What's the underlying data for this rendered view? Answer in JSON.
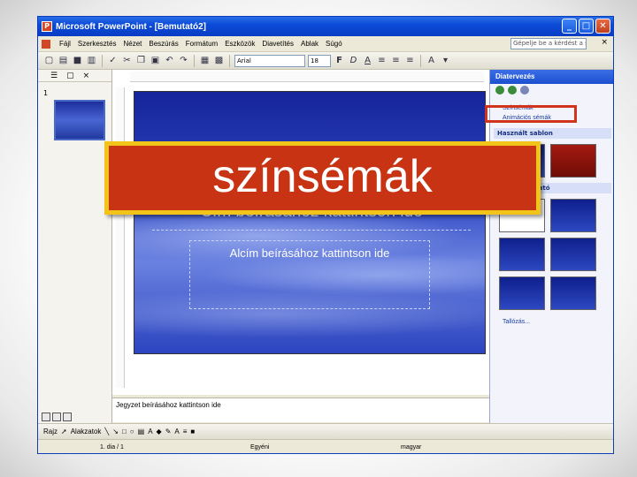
{
  "window": {
    "title": "Microsoft PowerPoint - [Bemutató2]",
    "min": "_",
    "max": "□",
    "close": "✕"
  },
  "menu": {
    "items": [
      "Fájl",
      "Szerkesztés",
      "Nézet",
      "Beszúrás",
      "Formátum",
      "Eszközök",
      "Diavetítés",
      "Ablak",
      "Súgó"
    ],
    "help_placeholder": "Gépelje be a kérdést a súgóhoz",
    "close": "×"
  },
  "toolbar": {
    "font_name": "Arial",
    "font_size": "18",
    "bold": "F",
    "italic": "D",
    "underline": "A"
  },
  "left_panel": {
    "slide_number": "1"
  },
  "slide": {
    "title_placeholder": "Cím beírásához kattintson ide",
    "subtitle_placeholder": "Alcím beírásához kattintson ide"
  },
  "notes": {
    "placeholder": "Jegyzet beírásához kattintson ide"
  },
  "task_pane": {
    "title": "Diatervezés",
    "link_color_schemes": "Színsémák",
    "link_animation": "Animációs sémák",
    "section_used": "Használt sablon",
    "section_available": "Felhasználható",
    "browse": "Tallózás..."
  },
  "drawbar": {
    "draw": "Rajz",
    "autoshapes": "Alakzatok"
  },
  "status": {
    "slide": "1. dia / 1",
    "design": "Egyéni",
    "language": "magyar"
  },
  "overlay": {
    "label": "színsémák",
    "accent": "#c73313",
    "border": "#f2c318"
  }
}
